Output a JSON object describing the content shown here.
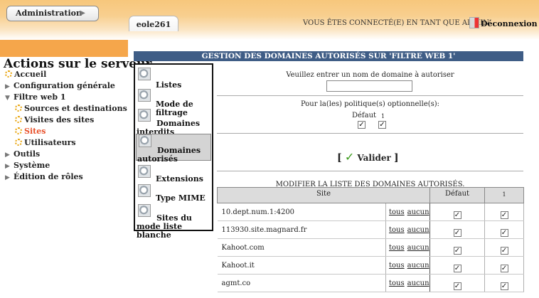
{
  "header": {
    "admin_label": "Administration",
    "admin_chevron": "▶",
    "tab_label": "eole261",
    "connected_text": "VOUS ÊTES CONNECTÉ(E) EN TANT QUE ADMIN",
    "logout_label": "Déconnexion",
    "logout_icon": "logout-icon"
  },
  "sidebar": {
    "title": "Actions sur le serveur",
    "items": [
      {
        "label": "Accueil",
        "icon": "gear-icon",
        "level": 0
      },
      {
        "label": "Configuration générale",
        "icon": "triangle-right-icon",
        "level": 0
      },
      {
        "label": "Filtre web 1",
        "icon": "triangle-down-icon",
        "level": 0
      },
      {
        "label": "Sources et destinations",
        "icon": "gear-icon",
        "level": 1
      },
      {
        "label": "Visites des sites",
        "icon": "gear-icon",
        "level": 1
      },
      {
        "label": "Sites",
        "icon": "gear-icon",
        "level": 1,
        "active": true
      },
      {
        "label": "Utilisateurs",
        "icon": "gear-icon",
        "level": 1
      },
      {
        "label": "Outils",
        "icon": "triangle-right-icon",
        "level": 0
      },
      {
        "label": "Système",
        "icon": "triangle-right-icon",
        "level": 0
      },
      {
        "label": "Édition de rôles",
        "icon": "triangle-right-icon",
        "level": 0
      }
    ]
  },
  "modules": [
    {
      "label": "Listes"
    },
    {
      "label": "Mode de filtrage"
    },
    {
      "label": "Domaines interdits"
    },
    {
      "label": "Domaines autorisés",
      "selected": true
    },
    {
      "label": "Extensions"
    },
    {
      "label": "Type MIME"
    },
    {
      "label": "Sites du mode liste blanche"
    }
  ],
  "main": {
    "section_title": "GESTION DES DOMAINES AUTORISÉS SUR 'FILTRE WEB 1'",
    "prompt": "Veuillez entrer un nom de domaine à autoriser",
    "domain_value": "",
    "policy_label": "Pour la(les) politique(s) optionnelle(s):",
    "policy_default": "Défaut",
    "policy_one": "1",
    "check_mark": "✓",
    "bracket_open": "[",
    "bracket_close": "]",
    "submit_label": "Valider",
    "list_title": "MODIFIER LA LISTE DES DOMAINES AUTORISÉS.",
    "columns": {
      "site": "Site",
      "default": "Défaut",
      "one": "1"
    },
    "link_all": "tous",
    "link_none": "aucun",
    "rows": [
      {
        "site": "10.dept.num.1:4200"
      },
      {
        "site": "113930.site.magnard.fr"
      },
      {
        "site": "Kahoot.com"
      },
      {
        "site": "Kahoot.it"
      },
      {
        "site": "agmt.co"
      }
    ]
  }
}
